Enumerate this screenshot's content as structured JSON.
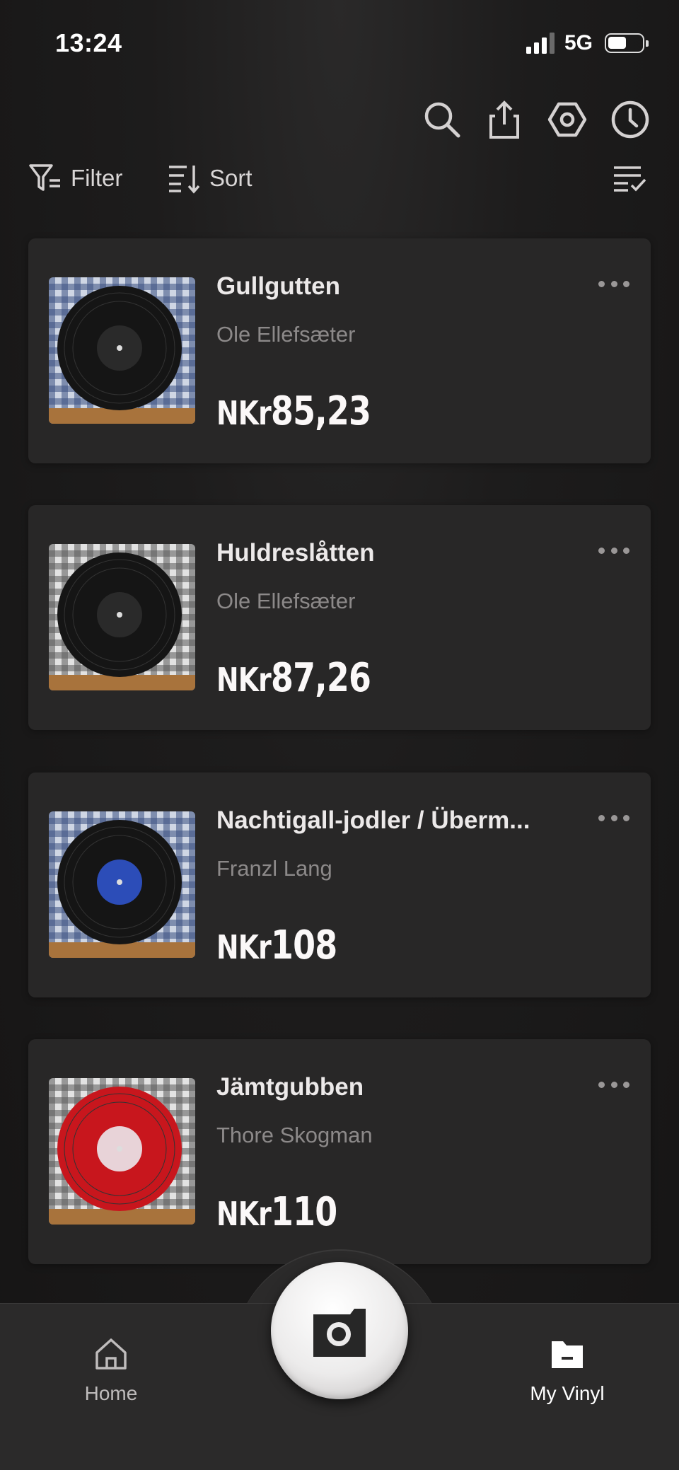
{
  "status_bar": {
    "time": "13:24",
    "network": "5G",
    "battery_level": 0.5
  },
  "header": {
    "icons": [
      "search-icon",
      "share-icon",
      "settings-icon",
      "history-icon"
    ],
    "filter_label": "Filter",
    "sort_label": "Sort"
  },
  "records": [
    {
      "title": "Gullgutten",
      "artist": "Ole Ellefsæter",
      "currency": "NKr",
      "price": "85,23",
      "label_color": "#2a2a2a",
      "vinyl_color": "#151515",
      "background": "blue"
    },
    {
      "title": "Huldreslåtten",
      "artist": "Ole Ellefsæter",
      "currency": "NKr",
      "price": "87,26",
      "label_color": "#2a2a2a",
      "vinyl_color": "#151515",
      "background": "grey"
    },
    {
      "title": "Nachtigall-jodler / Überm...",
      "artist": "Franzl Lang",
      "currency": "NKr",
      "price": "108",
      "label_color": "#2c4db8",
      "vinyl_color": "#151515",
      "background": "blue"
    },
    {
      "title": "Jämtgubben",
      "artist": "Thore Skogman",
      "currency": "NKr",
      "price": "110",
      "label_color": "#e8d3d8",
      "vinyl_color": "#c8161d",
      "background": "grey"
    }
  ],
  "tabbar": {
    "home_label": "Home",
    "my_vinyl_label": "My Vinyl",
    "active_tab": "My Vinyl"
  },
  "colors": {
    "background": "#1a1919",
    "card": "#282727",
    "text_primary": "#ece9e9",
    "text_secondary": "#8c8989"
  }
}
